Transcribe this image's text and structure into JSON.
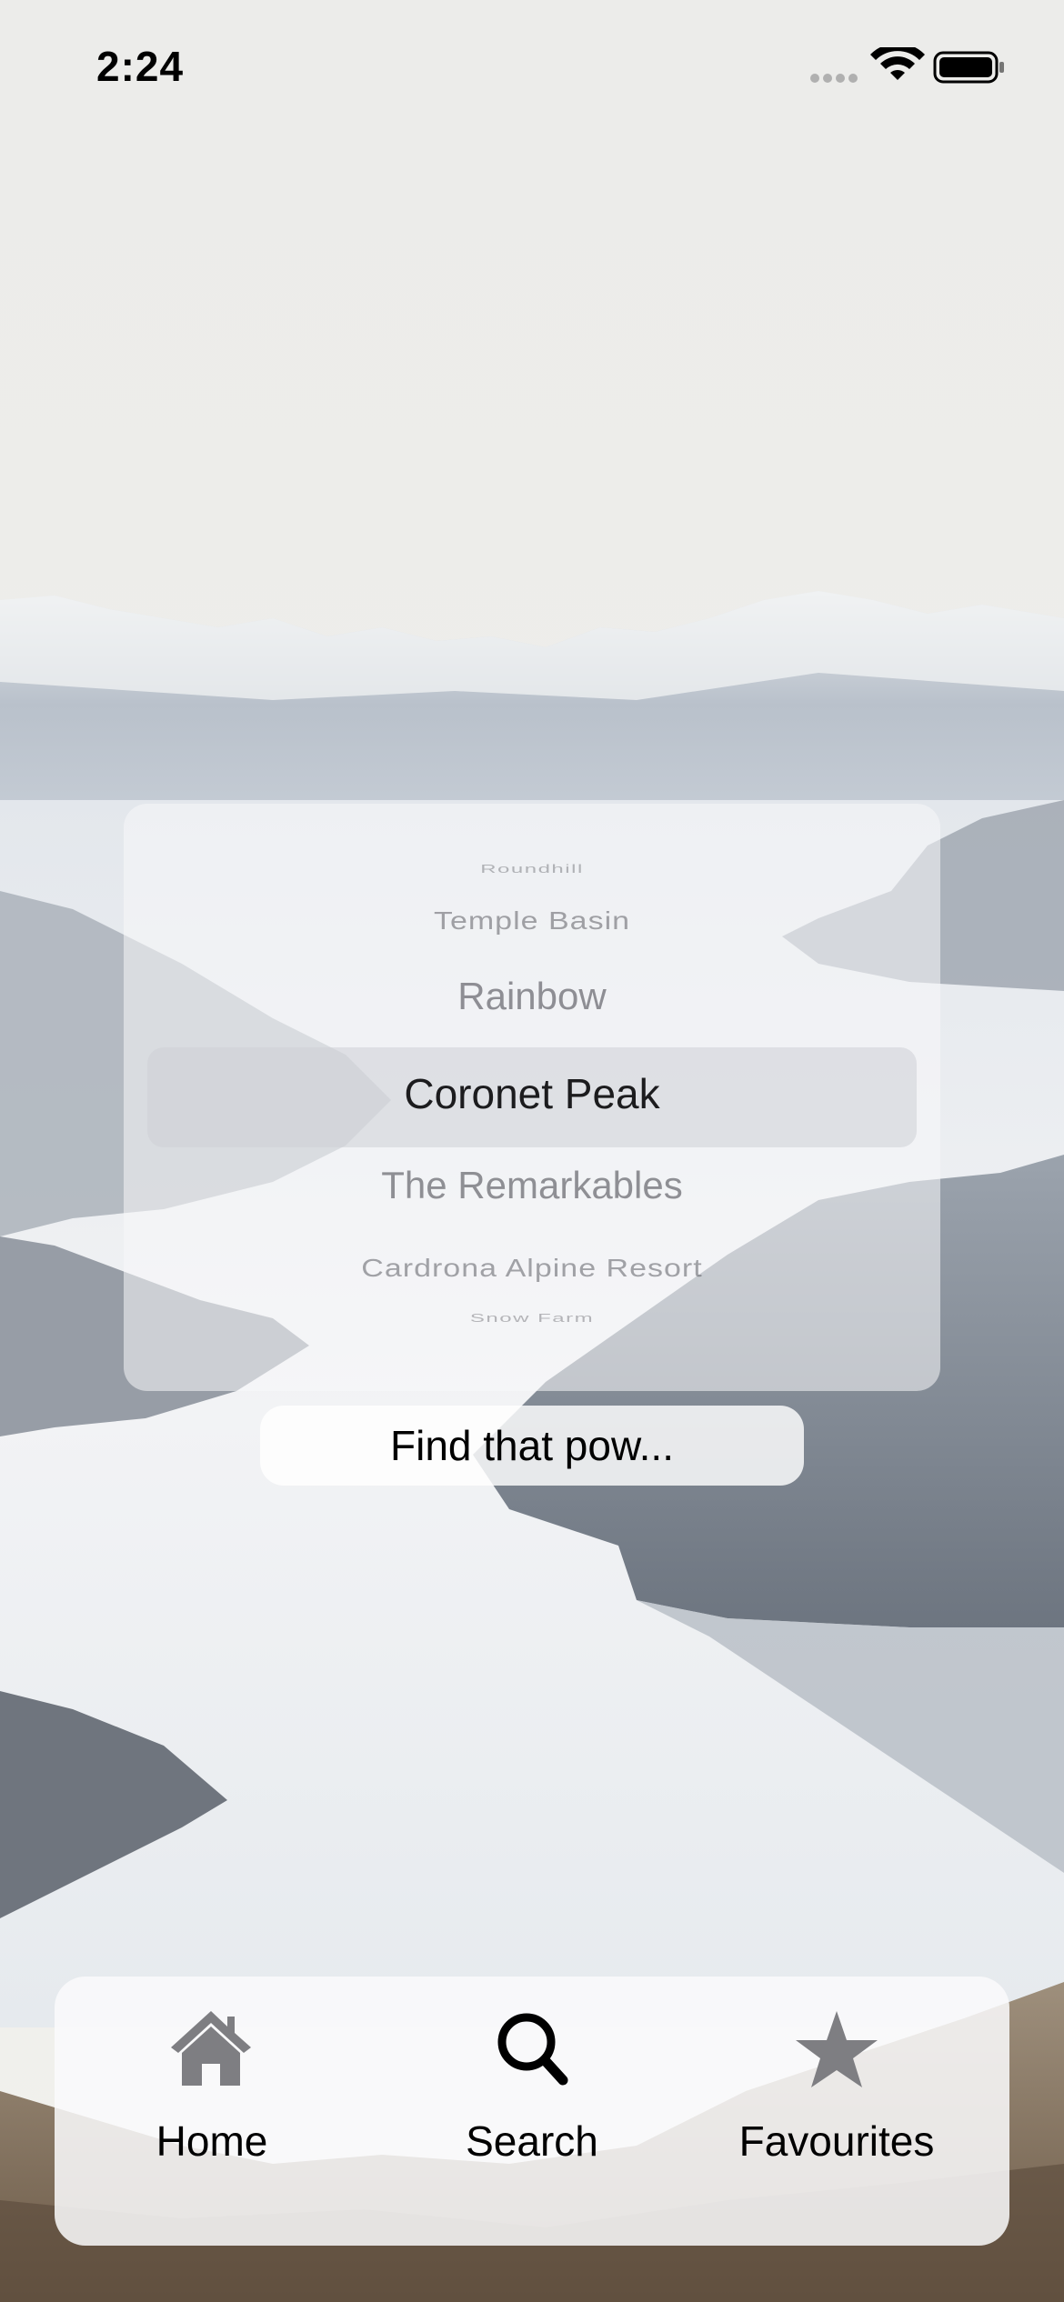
{
  "status_bar": {
    "time": "2:24",
    "signal_icon": "signal-dots-icon",
    "wifi_icon": "wifi-icon",
    "battery_icon": "battery-icon"
  },
  "picker": {
    "items": [
      "Roundhill",
      "Temple Basin",
      "Rainbow",
      "Coronet Peak",
      "The Remarkables",
      "Cardrona Alpine Resort",
      "Snow Farm"
    ],
    "selected": "Coronet Peak"
  },
  "search_button": {
    "label": "Find that pow..."
  },
  "tab_bar": {
    "tabs": [
      {
        "label": "Home",
        "icon": "house-icon",
        "color": "#8e8e93"
      },
      {
        "label": "Search",
        "icon": "magnifier-icon",
        "color": "#000000"
      },
      {
        "label": "Favourites",
        "icon": "star-icon",
        "color": "#8e8e93"
      }
    ]
  }
}
